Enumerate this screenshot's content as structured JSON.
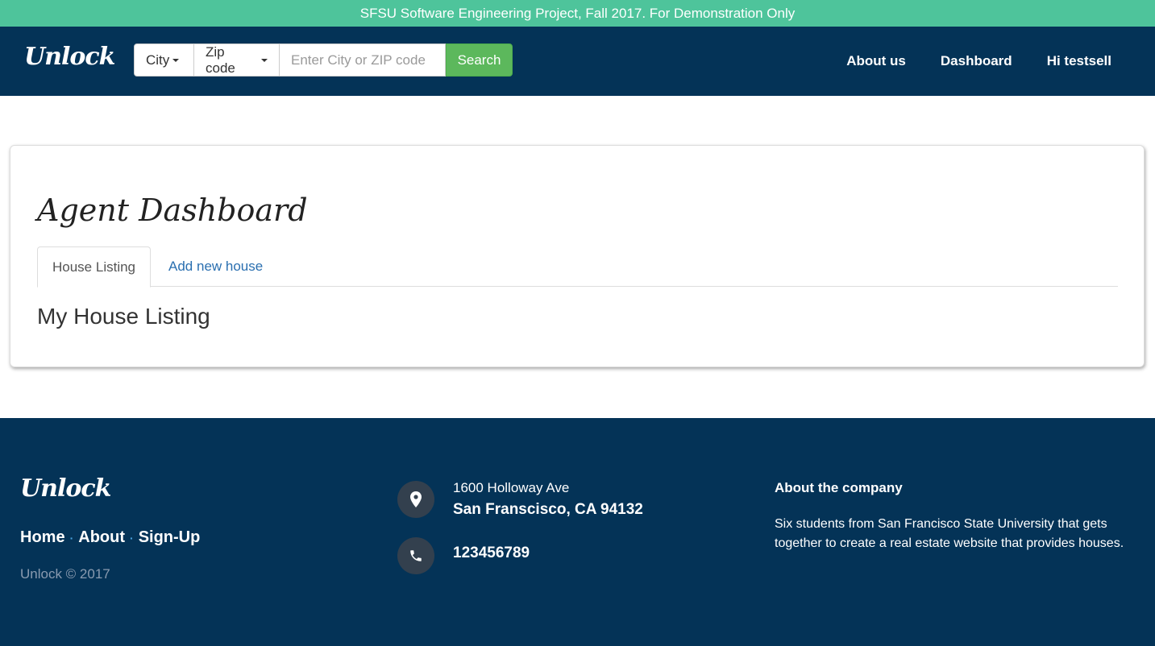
{
  "banner": {
    "text": "SFSU Software Engineering Project, Fall 2017. For Demonstration Only",
    "color": "#4ec49b"
  },
  "navbar": {
    "brand": "Unlock",
    "background": "#043357",
    "search": {
      "city_dropdown": "City",
      "zip_dropdown": "Zip code",
      "input_placeholder": "Enter City or ZIP code",
      "input_value": "",
      "button_label": "Search"
    },
    "links": [
      {
        "label": "About us"
      },
      {
        "label": "Dashboard"
      },
      {
        "label": "Hi testsell"
      }
    ]
  },
  "main": {
    "title": "Agent Dashboard",
    "tabs": [
      {
        "label": "House Listing",
        "active": true
      },
      {
        "label": "Add new house",
        "active": false
      }
    ],
    "section_title": "My House Listing"
  },
  "footer": {
    "brand": "Unlock",
    "links": [
      {
        "label": "Home"
      },
      {
        "label": "About"
      },
      {
        "label": "Sign-Up"
      }
    ],
    "separator": "·",
    "copyright": "Unlock © 2017",
    "address_line1": "1600 Holloway Ave",
    "address_line2": "San Franscisco, CA 94132",
    "phone": "123456789",
    "about_heading": "About the company",
    "about_text": "Six students from San Francisco State University that gets together to create a real estate website that provides houses.",
    "icons": {
      "location": "map-marker-icon",
      "phone": "phone-icon"
    }
  }
}
